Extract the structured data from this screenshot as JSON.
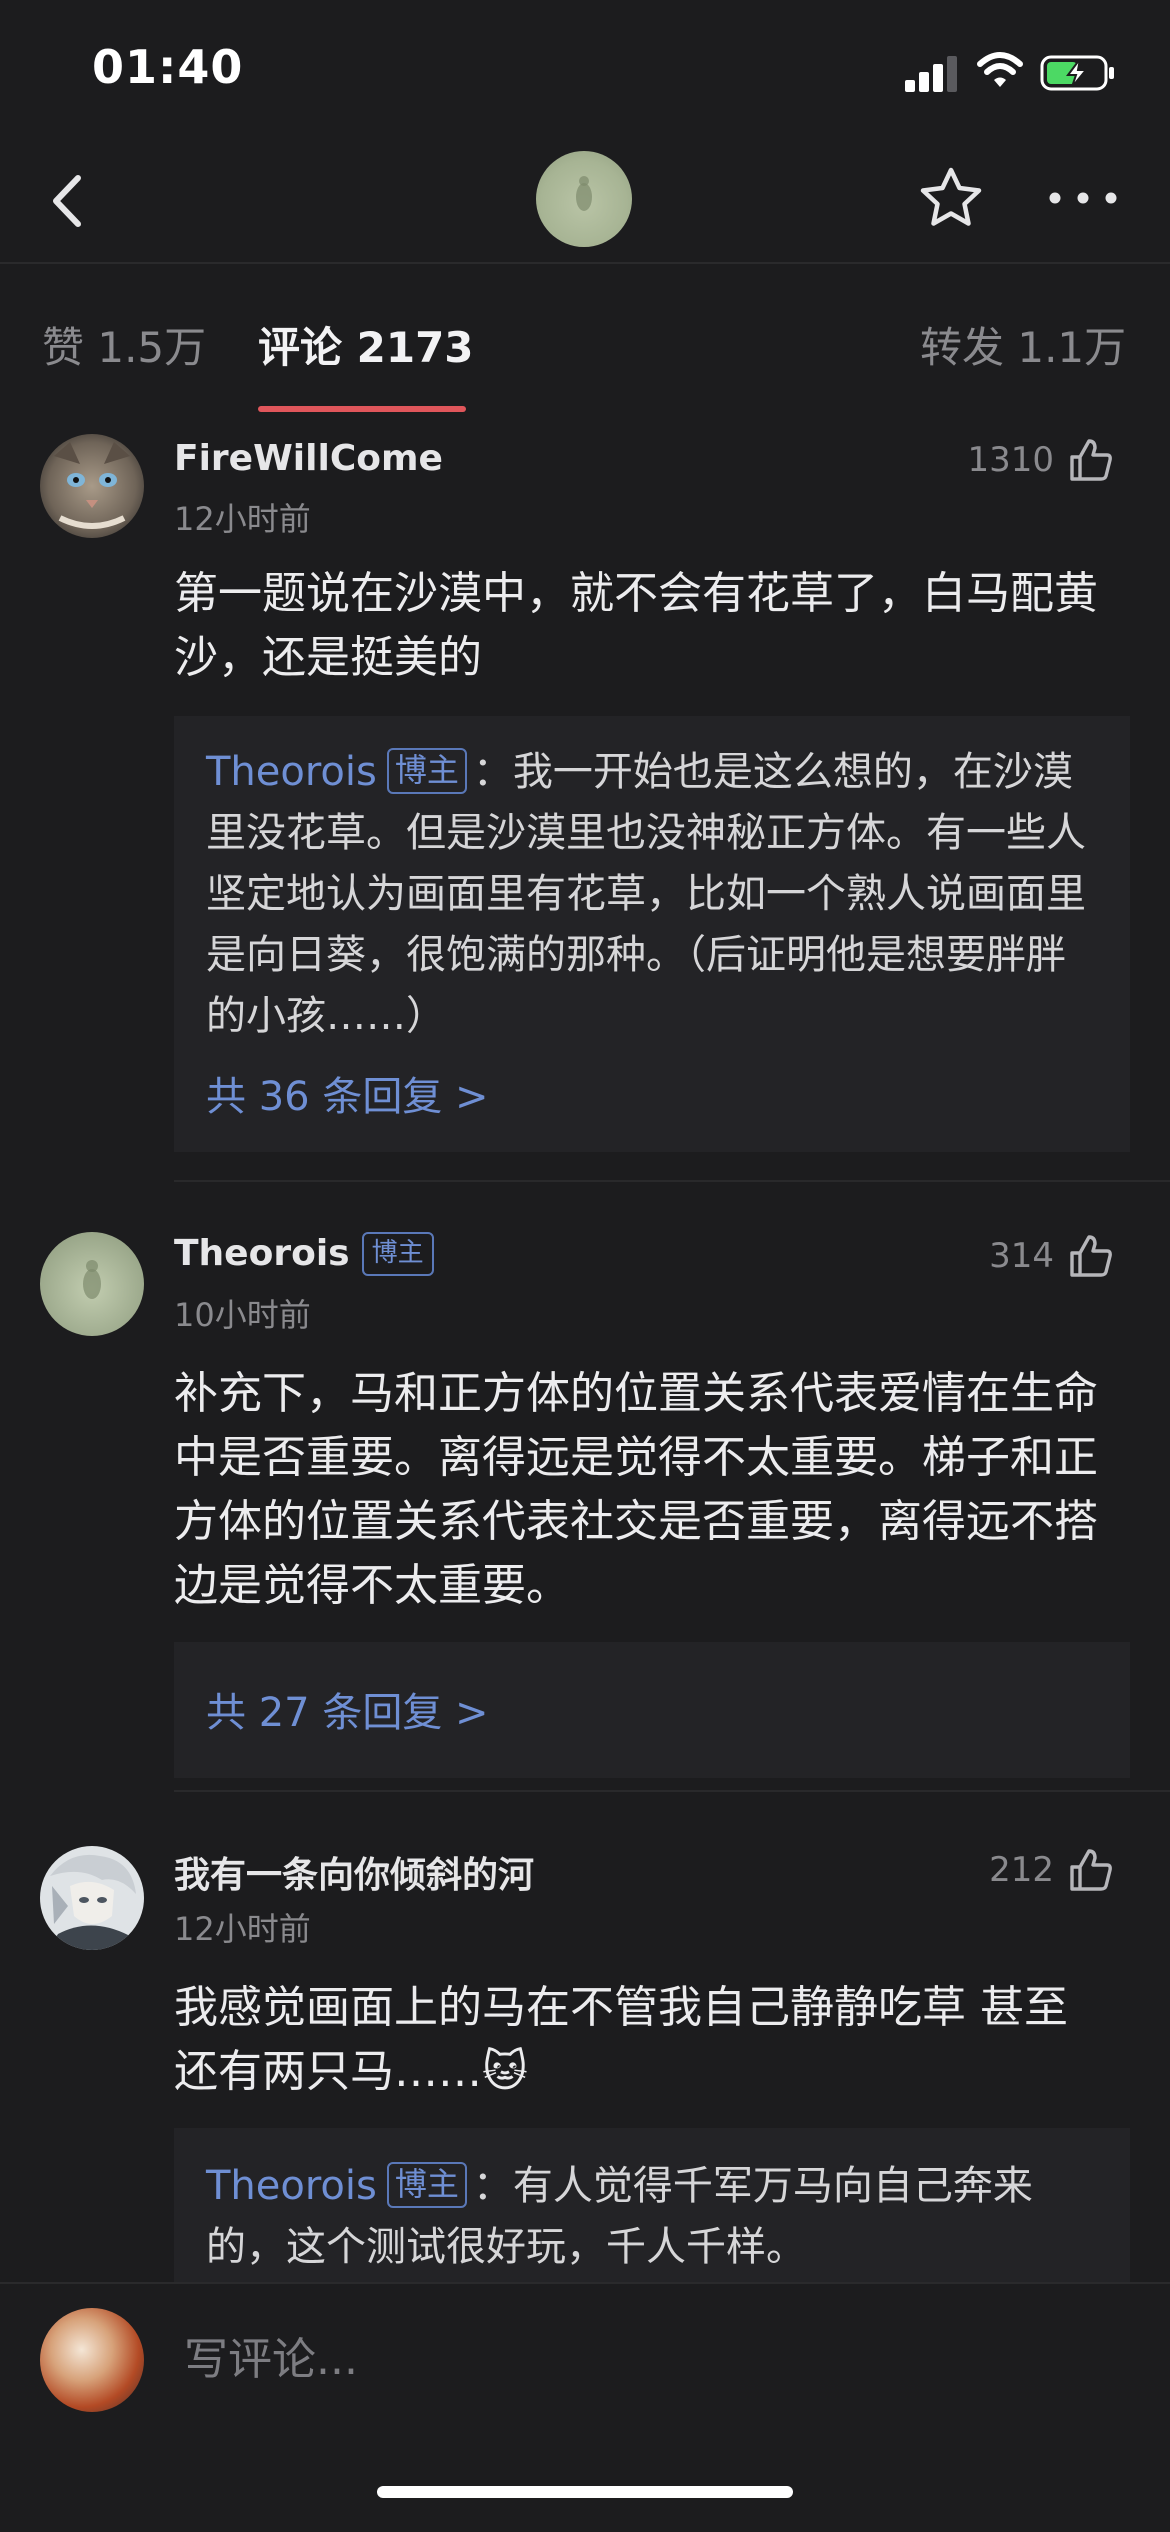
{
  "status_bar": {
    "time": "01:40"
  },
  "nav": {
    "back_icon": "chevron-left-icon",
    "star_icon": "star-outline-icon",
    "more_icon": "more-horizontal-icon"
  },
  "tabs": [
    {
      "label": "赞 1.5万",
      "active": false
    },
    {
      "label": "评论 2173",
      "active": true
    },
    {
      "label": "转发 1.1万",
      "active": false
    }
  ],
  "comments": [
    {
      "username": "FireWillCome",
      "badge": "",
      "time": "12小时前",
      "likes": "1310",
      "text": "第一题说在沙漠中，就不会有花草了，白马配黄沙，还是挺美的",
      "reply": {
        "author": "Theorois",
        "badge": "博主",
        "text": "：我一开始也是这么想的，在沙漠里没花草。但是沙漠里也没神秘正方体。有一些人坚定地认为画面里有花草，比如一个熟人说画面里是向日葵，很饱满的那种。（后证明他是想要胖胖的小孩……）",
        "count": "共 36 条回复 >"
      }
    },
    {
      "username": "Theorois",
      "badge": "博主",
      "time": "10小时前",
      "likes": "314",
      "text": "补充下，马和正方体的位置关系代表爱情在生命中是否重要。离得远是觉得不太重要。梯子和正方体的位置关系代表社交是否重要，离得远不搭边是觉得不太重要。",
      "reply": {
        "count": "共 27 条回复 >"
      }
    },
    {
      "username": "我有一条向你倾斜的河",
      "badge": "",
      "time": "12小时前",
      "likes": "212",
      "text": "我感觉画面上的马在不管我自己静静吃草 甚至还有两只马……",
      "emoji": "🐱",
      "reply": {
        "author": "Theorois",
        "badge": "博主",
        "text": "：有人觉得千军万马向自己奔来的，这个测试很好玩，千人千样。"
      }
    }
  ],
  "input": {
    "placeholder": "写评论..."
  }
}
